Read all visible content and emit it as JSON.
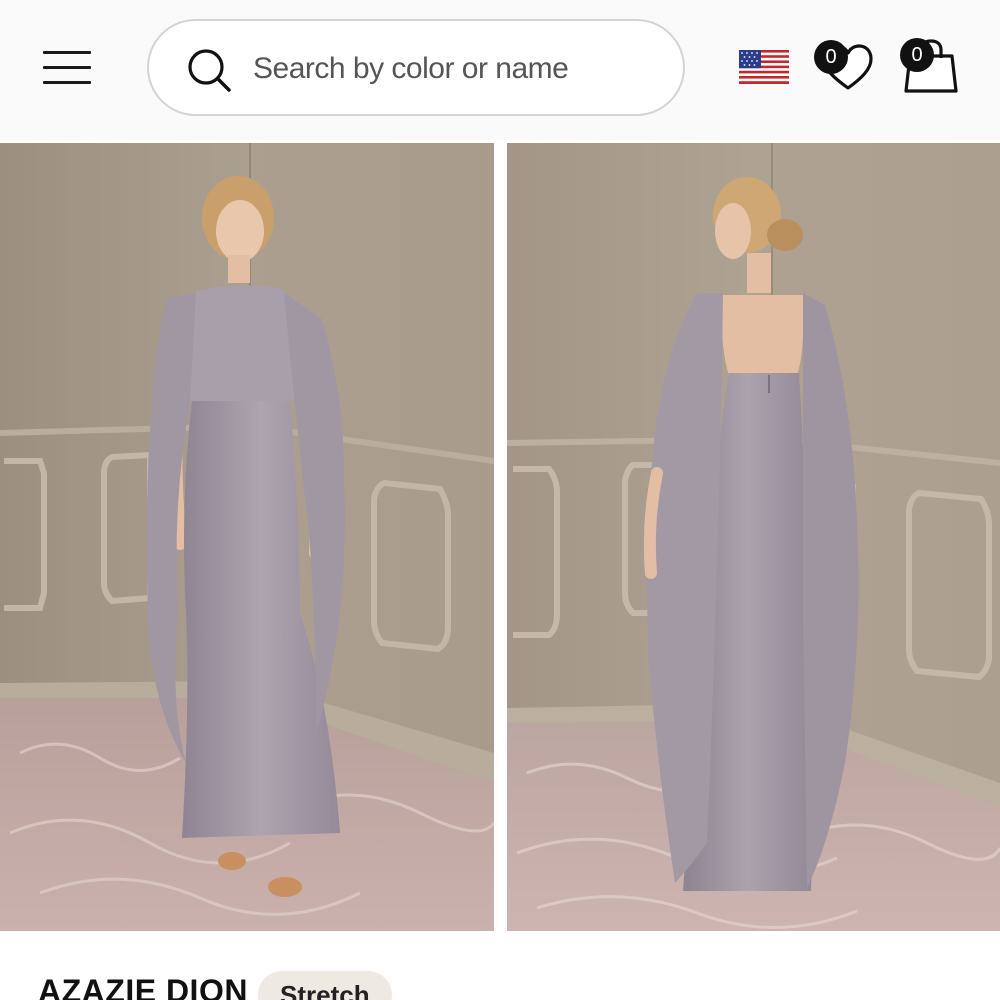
{
  "header": {
    "menu_icon": "hamburger-menu-icon",
    "search": {
      "placeholder": "Search by color or name",
      "value": "",
      "icon": "search-icon"
    },
    "region_flag": "us-flag-icon",
    "wishlist": {
      "icon": "heart-icon",
      "count": "0"
    },
    "cart": {
      "icon": "shopping-bag-icon",
      "count": "0"
    }
  },
  "gallery": {
    "images": [
      {
        "view": "front",
        "dress_color": "#a59ba6"
      },
      {
        "view": "back",
        "dress_color": "#a59ba6"
      }
    ]
  },
  "product": {
    "title": "AZAZIE DION",
    "tag": "Stretch"
  },
  "colors": {
    "header_bg": "#fbfafa",
    "search_border": "#d6d3d1",
    "wall": "#a79b8c",
    "dress": "#a59ba6",
    "rug": "#c7aaa6",
    "tag_bg": "#efe9e4"
  }
}
